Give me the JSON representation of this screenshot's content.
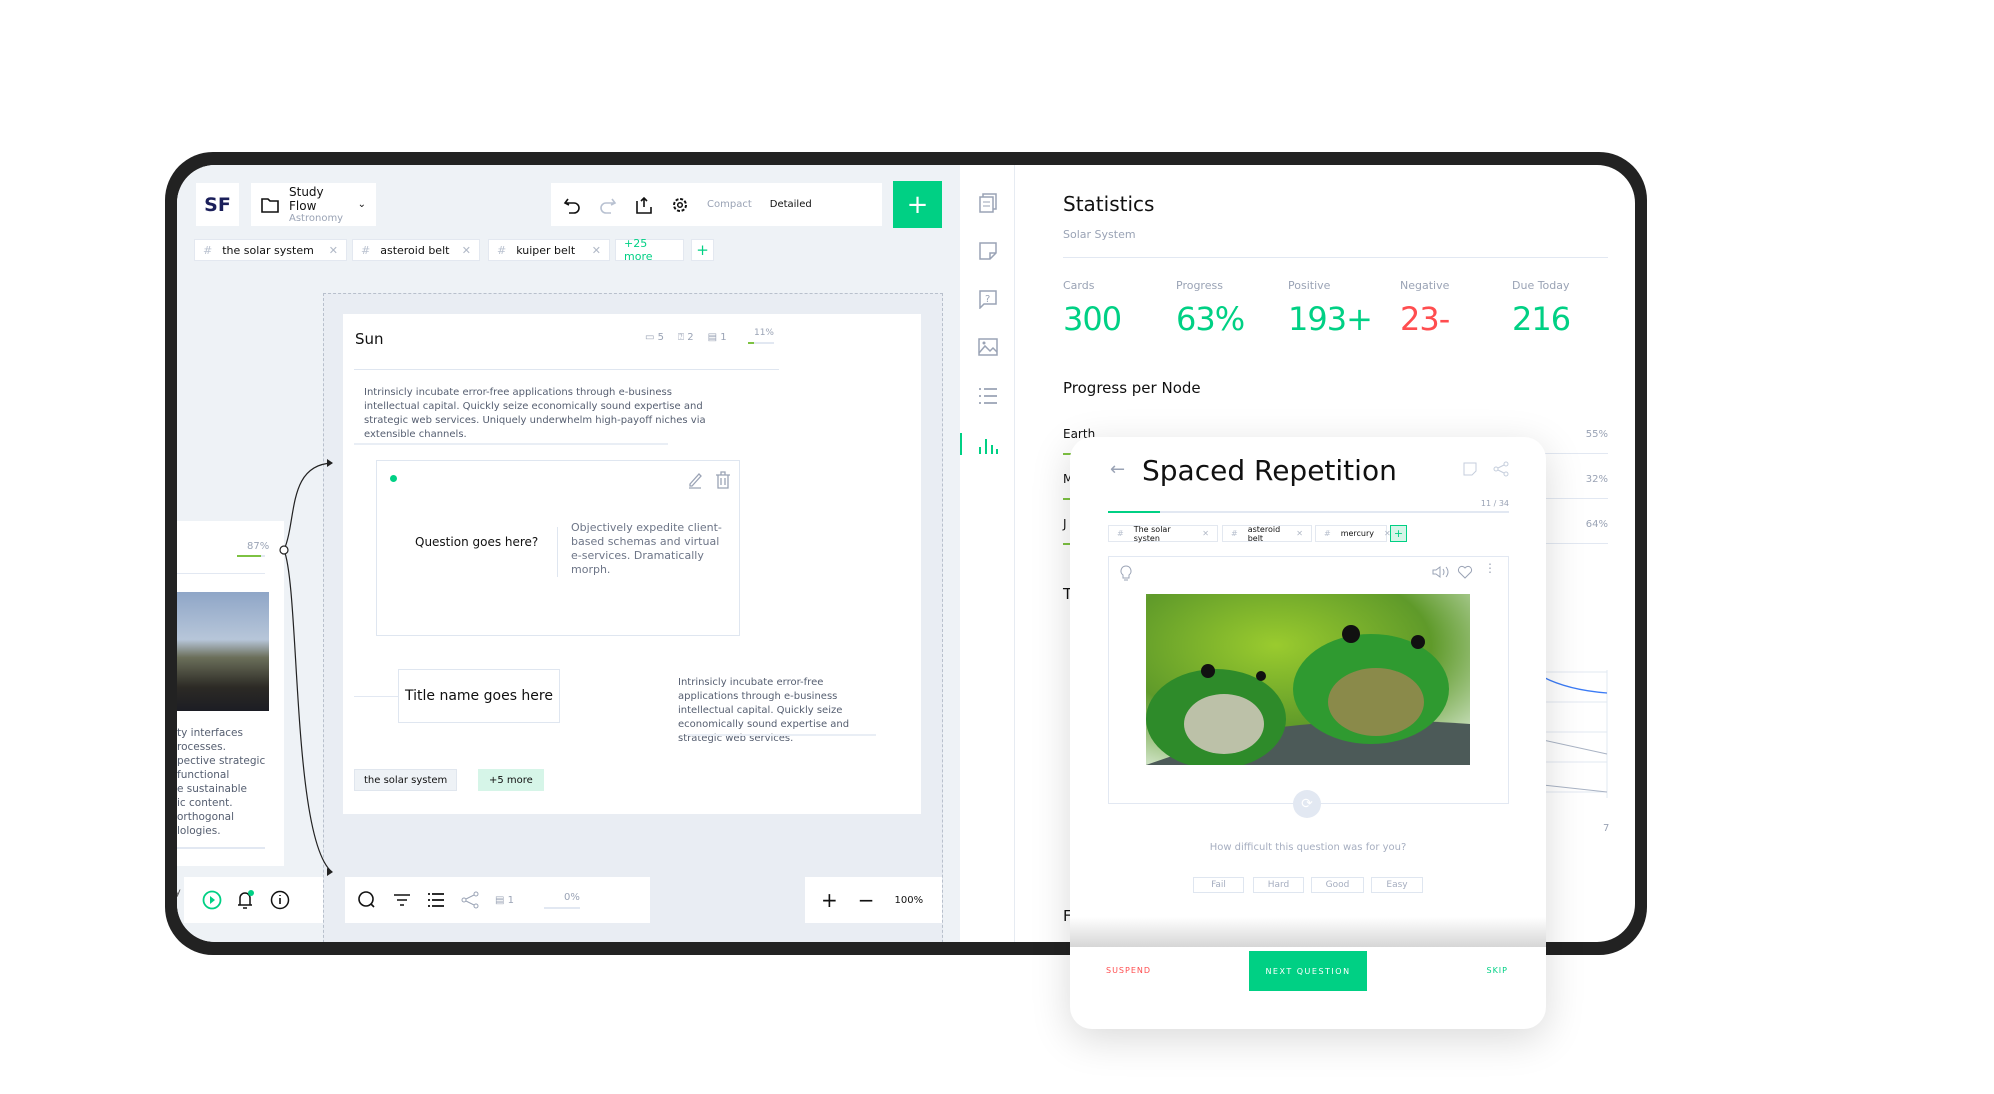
{
  "app": {
    "logo": "SF",
    "project_name": "Study Flow",
    "project_sub": "Astronomy"
  },
  "toolbar": {
    "compact": "Compact",
    "detailed": "Detailed",
    "add": "+"
  },
  "tags": [
    {
      "label": "the solar system"
    },
    {
      "label": "asteroid belt"
    },
    {
      "label": "kuiper belt"
    }
  ],
  "tags_more": "+25 more",
  "tags_add": "+",
  "left_card": {
    "percent": "87%",
    "progress": 0.87,
    "text": [
      "ty interfaces",
      "rocesses.",
      "pective strategic",
      "functional",
      "e sustainable",
      "ic content.",
      "orthogonal",
      "lologies."
    ],
    "footer_partial": "ty"
  },
  "node": {
    "title": "Sun",
    "notes": "5",
    "questions": "2",
    "cards": "1",
    "percent": "11%",
    "progress": 0.11,
    "description": "Intrinsicly incubate error-free applications through e-business intellectual capital. Quickly seize economically sound expertise and strategic web services. Uniquely underwhelm high-payoff niches via extensible channels.",
    "question": "Question goes here?",
    "answer": "Objectively expedite client-based schemas and virtual e-services. Dramatically morph.",
    "child_title": "Title name goes here",
    "child_text": "Intrinsicly incubate error-free applications through e-business intellectual capital. Quickly seize economically sound expertise and strategic web services.",
    "tag": "the solar system",
    "tag_more": "+5 more"
  },
  "bottom": {
    "cards": "1",
    "percent": "0%",
    "zoom": "100%"
  },
  "stats": {
    "title": "Statistics",
    "subtitle": "Solar System",
    "kpis": [
      {
        "label": "Cards",
        "value": "300",
        "color": "#00d084"
      },
      {
        "label": "Progress",
        "value": "63%",
        "color": "#00d084"
      },
      {
        "label": "Positive",
        "value": "193+",
        "color": "#00d084"
      },
      {
        "label": "Negative",
        "value": "23-",
        "color": "#ff4d4f"
      },
      {
        "label": "Due Today",
        "value": "216",
        "color": "#00d084"
      }
    ],
    "ppn_title": "Progress per Node",
    "nodes": [
      {
        "name": "Earth",
        "pct": "55%"
      },
      {
        "name": "M",
        "pct": "32%"
      },
      {
        "name": "J",
        "pct": "64%"
      }
    ],
    "section_t": "T",
    "chart_tick": "7",
    "section_f": "F"
  },
  "modal": {
    "title": "Spaced Repetition",
    "counter": "11 / 34",
    "progress": 0.32,
    "tags": [
      {
        "label": "The solar systen"
      },
      {
        "label": "asteroid belt"
      },
      {
        "label": "mercury"
      }
    ],
    "tag_add": "+",
    "question": "How difficult this question was for you?",
    "ratings": [
      "Fail",
      "Hard",
      "Good",
      "Easy"
    ],
    "suspend": "SUSPEND",
    "next": "NEXT QUESTION",
    "skip": "SKIP"
  },
  "colors": {
    "accent": "#00d084",
    "danger": "#ff4d4f",
    "chart_line": "#3b7bf5"
  }
}
